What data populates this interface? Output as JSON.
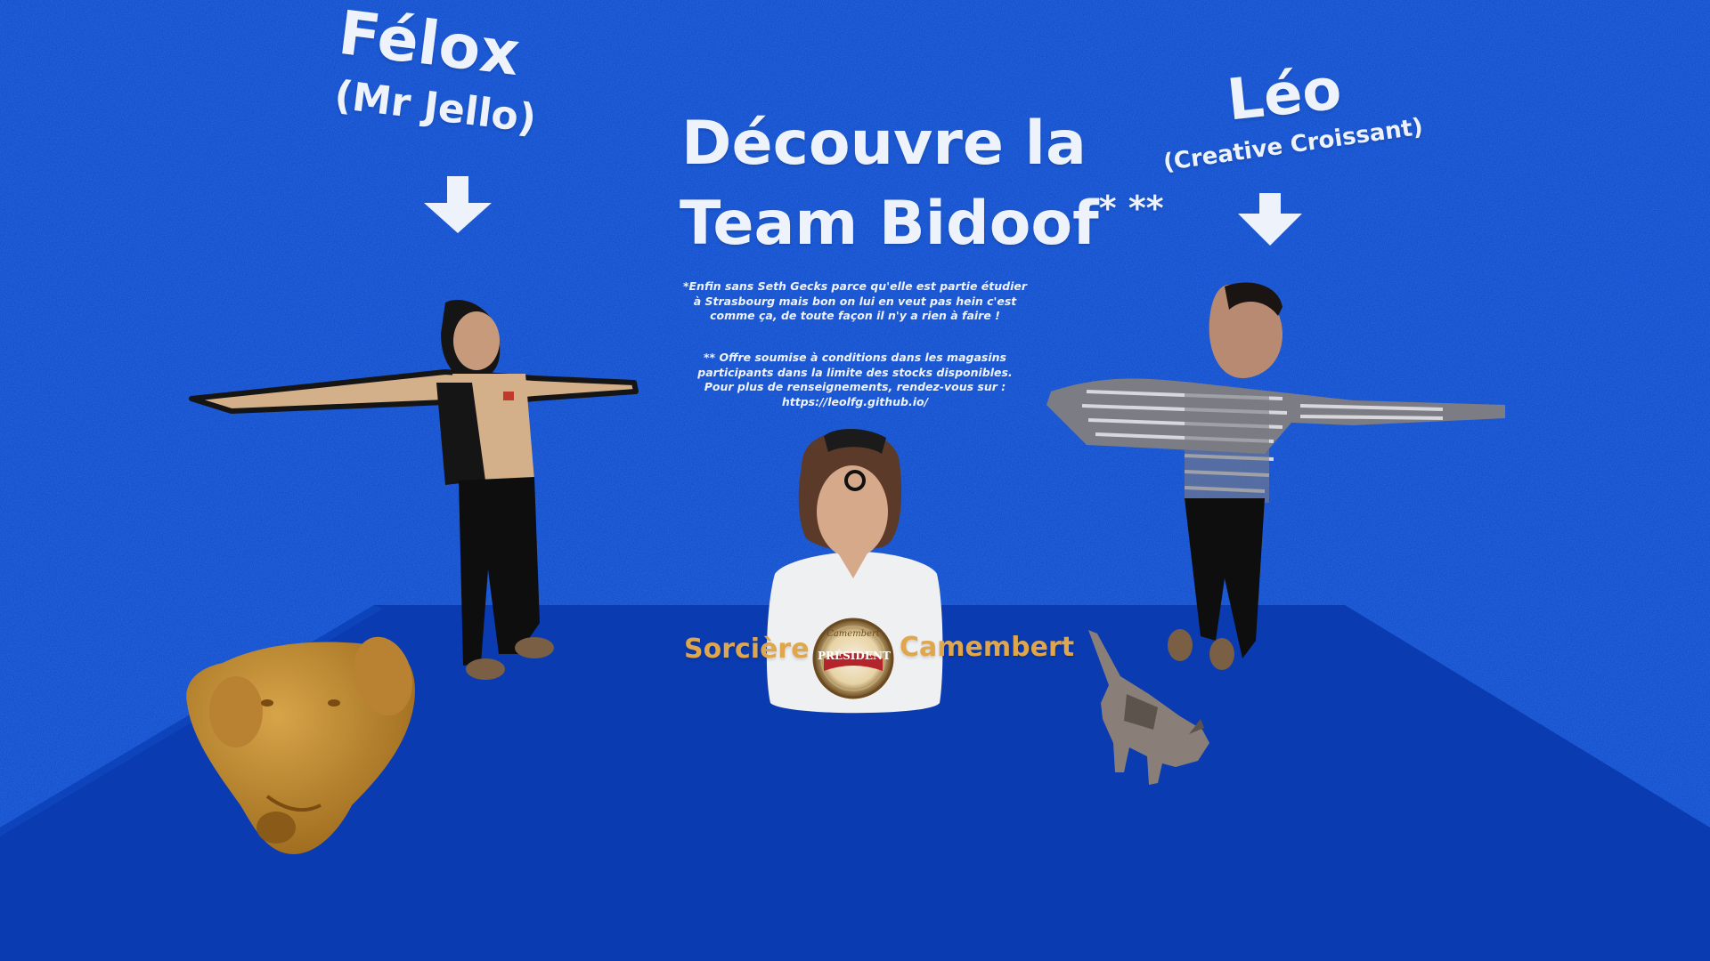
{
  "title": {
    "line1": "Découvre la",
    "line2": "Team Bidoof",
    "asterisks": "* **"
  },
  "felox": {
    "name": "Félox",
    "nickname": "(Mr Jello)"
  },
  "leo": {
    "name": "Léo",
    "nickname": "(Creative Croissant)"
  },
  "footnote1": [
    "*Enfin sans Seth Gecks parce qu'elle est partie étudier",
    "à Strasbourg mais bon on lui en veut pas hein c'est",
    "comme ça, de toute façon il n'y a rien à faire !"
  ],
  "footnote2": [
    "** Offre soumise à conditions dans les magasins",
    "participants dans la limite des stocks disponibles.",
    "Pour plus de renseignements, rendez-vous sur :",
    "https://leolfg.github.io/"
  ],
  "center": {
    "left_label": "Sorcière",
    "right_label": "Camembert",
    "badge_top": "Camembert",
    "badge_brand": "PRÉSIDENT"
  },
  "icons": [
    "arrow-down-icon",
    "crosshair-icon"
  ],
  "colors": {
    "wall": "#0b47c9",
    "floor": "#0a3bb0",
    "text": "#eef2fa",
    "gold": "#e0a64c"
  }
}
